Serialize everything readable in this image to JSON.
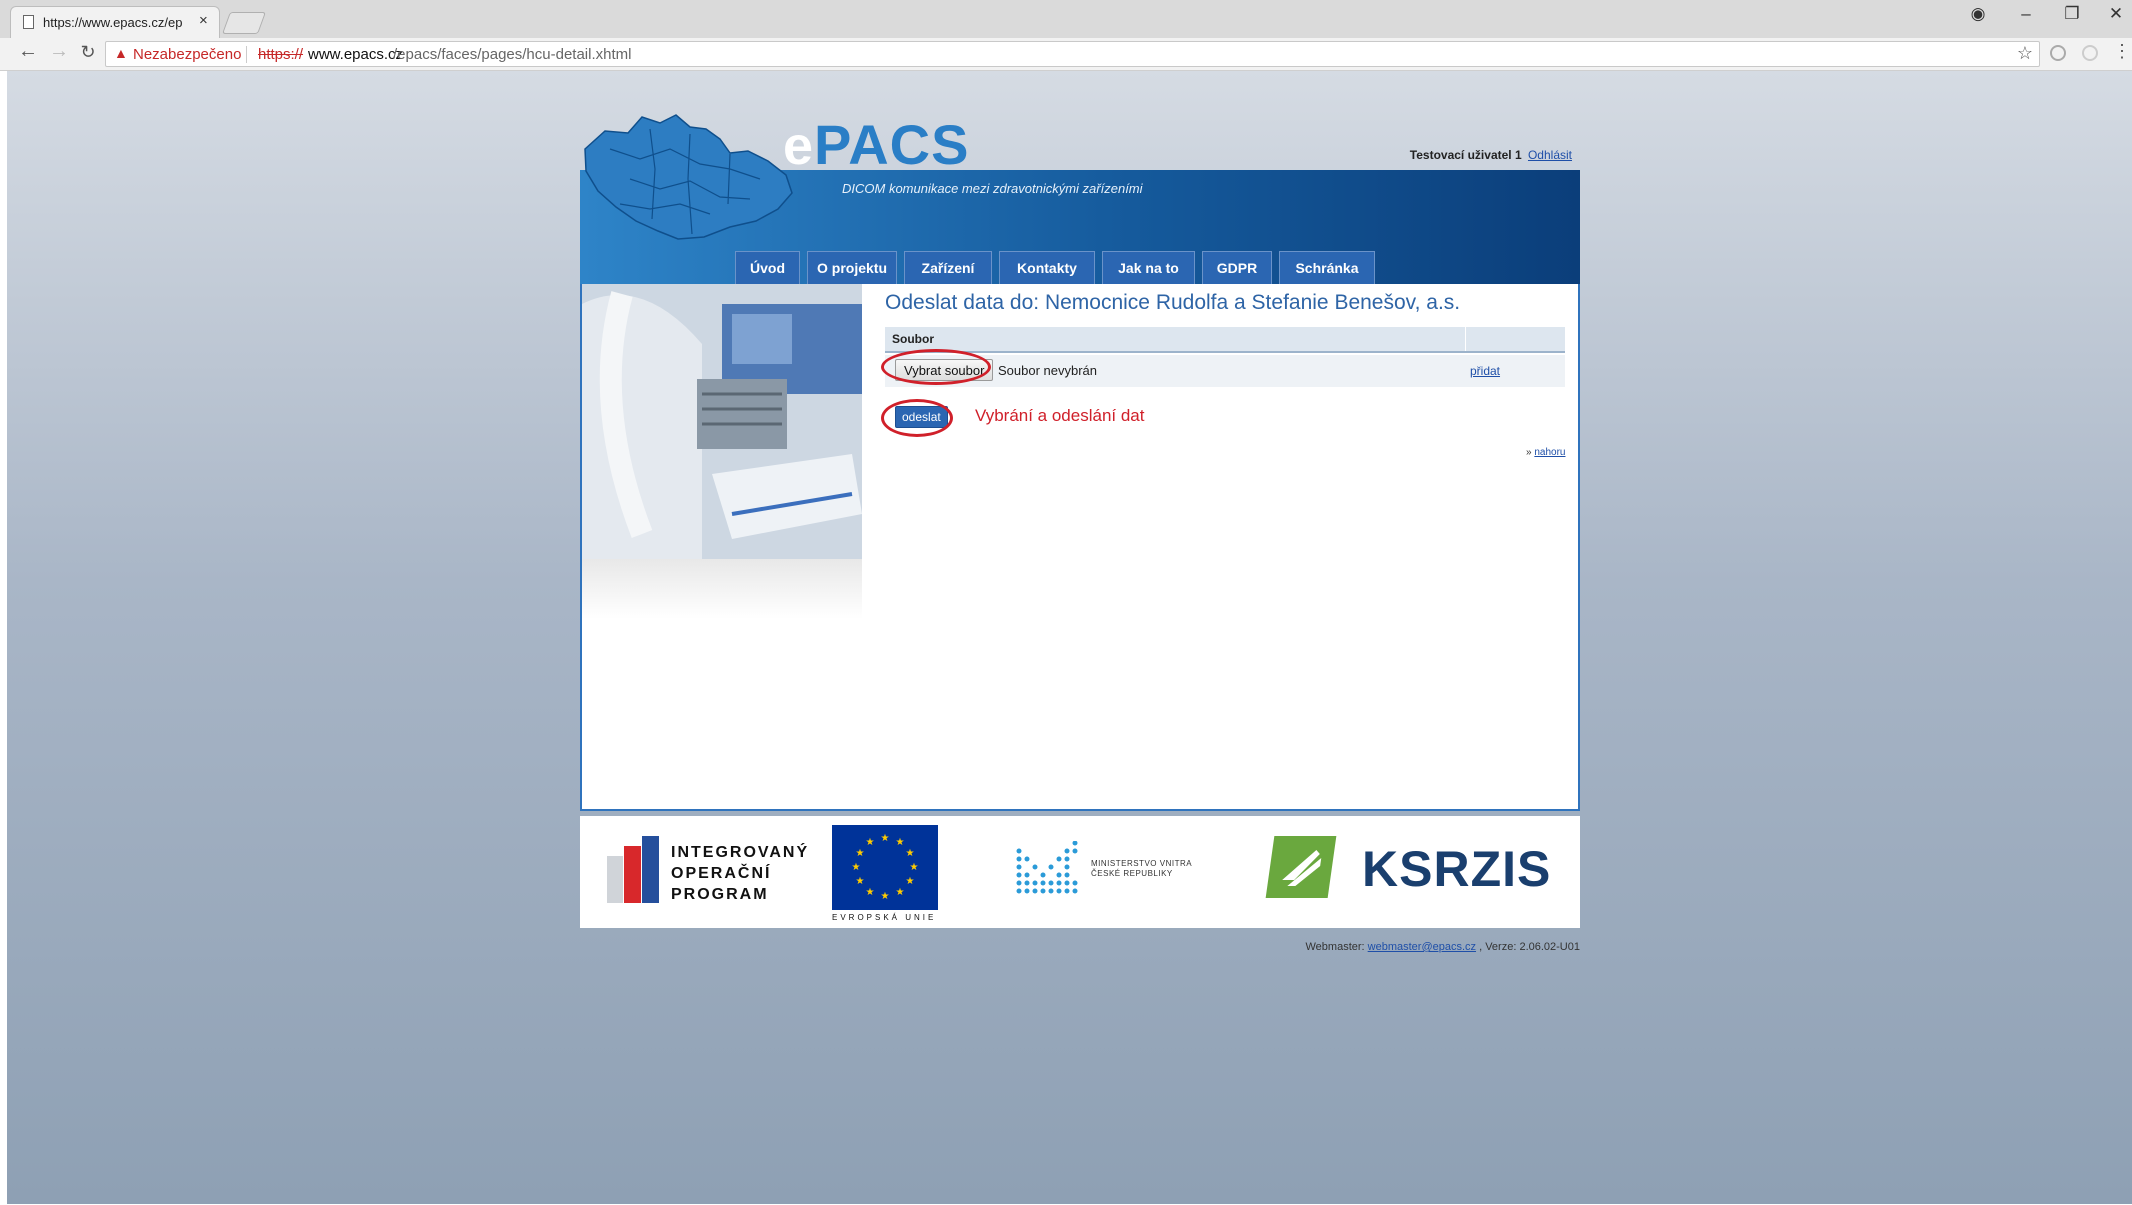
{
  "browser": {
    "tab_title": "https://www.epacs.cz/ep",
    "tab_close": "×",
    "warning_label": "Nezabezpečeno",
    "url_protocol": "https://",
    "url_host": "www.epacs.cz",
    "url_path": "/epacs/faces/pages/hcu-detail.xhtml",
    "nav_icons": [
      "back-icon",
      "forward-icon",
      "reload-icon"
    ],
    "window_icons": [
      "account-icon",
      "minimize-icon",
      "restore-icon",
      "close-icon"
    ]
  },
  "site": {
    "logo_text": "ePACS",
    "tagline": "DICOM komunikace mezi zdravotnickými zařízeními",
    "user_label": "Testovací uživatel 1",
    "logout_label": "Odhlásit",
    "nav": [
      "Úvod",
      "O projektu",
      "Zařízení",
      "Kontakty",
      "Jak na to",
      "GDPR",
      "Schránka"
    ]
  },
  "main": {
    "title": "Odeslat data do: Nemocnice Rudolfa a Stefanie Benešov, a.s.",
    "table_header": "Soubor",
    "choose_file_label": "Vybrat soubor",
    "no_file_text": "Soubor nevybrán",
    "add_link": "přidat",
    "send_label": "odeslat",
    "annotation": "Vybrání a odeslání dat",
    "to_top_prefix": "»",
    "to_top_label": "nahoru",
    "annotation_color": "#d0202a"
  },
  "logos": {
    "iop_lines": [
      "INTEGROVANÝ",
      "OPERAČNÍ",
      "PROGRAM"
    ],
    "eu_caption": "EVROPSKÁ UNIE",
    "mv_lines": [
      "MINISTERSTVO VNITRA",
      "ČESKÉ REPUBLIKY"
    ],
    "ksrzis": "KSRZIS"
  },
  "footer": {
    "webmaster_label": "Webmaster:",
    "webmaster_email": "webmaster@epacs.cz",
    "version_text": ", Verze: 2.06.02-U01"
  }
}
